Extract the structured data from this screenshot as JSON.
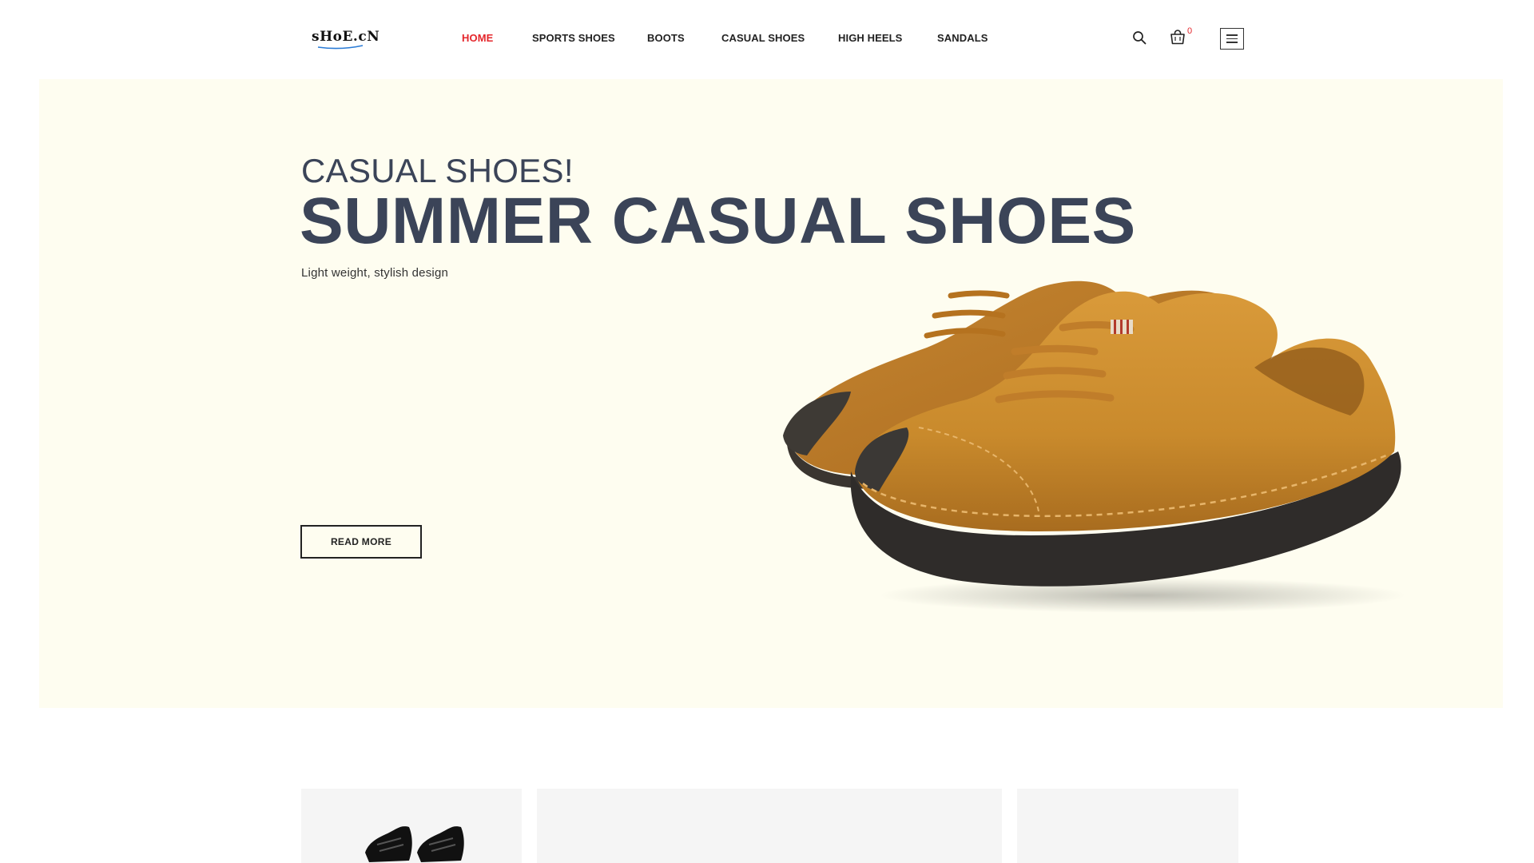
{
  "header": {
    "logo_text": "sHoE.cN",
    "nav": [
      {
        "label": "HOME",
        "active": true
      },
      {
        "label": "SPORTS SHOES",
        "active": false
      },
      {
        "label": "BOOTS",
        "active": false
      },
      {
        "label": "CASUAL SHOES",
        "active": false
      },
      {
        "label": "HIGH HEELS",
        "active": false
      },
      {
        "label": "SANDALS",
        "active": false
      }
    ],
    "cart_count": "0",
    "icons": [
      "search-icon",
      "cart-icon",
      "menu-icon"
    ]
  },
  "hero": {
    "subtitle": "CASUAL SHOES!",
    "title": "SUMMER CASUAL SHOES",
    "description": "Light weight, stylish design",
    "button_label": "READ MORE",
    "background_color": "#fefdf0",
    "title_color": "#3b4458"
  },
  "colors": {
    "accent": "#e4262b",
    "text_dark": "#222222",
    "card_bg": "#f5f5f5"
  }
}
